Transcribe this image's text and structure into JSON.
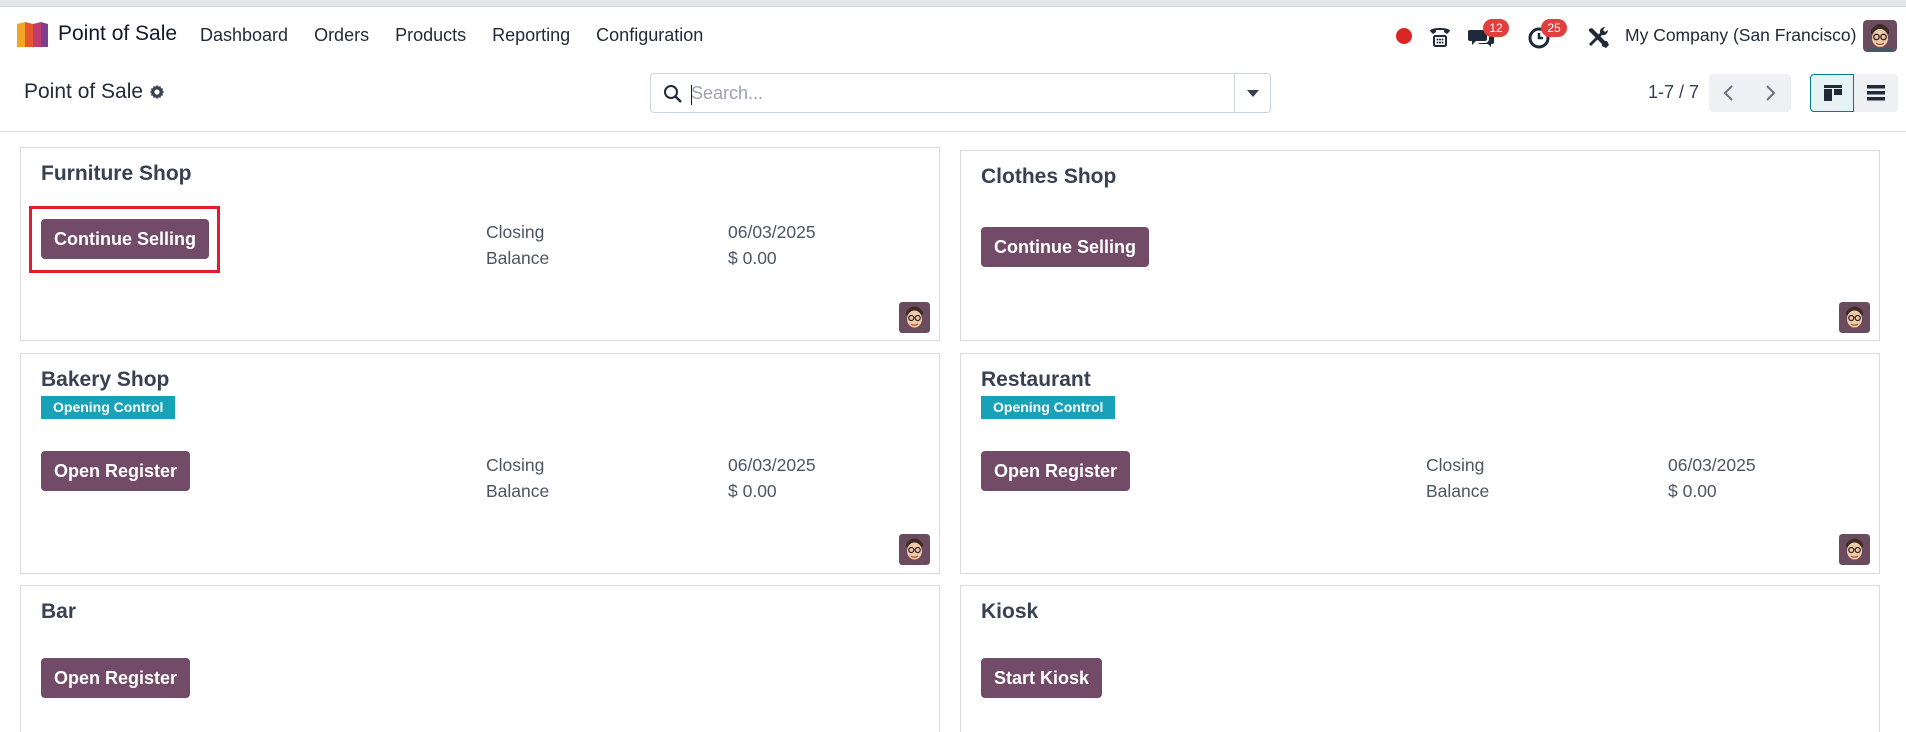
{
  "app": {
    "name": "Point of Sale"
  },
  "menu": [
    "Dashboard",
    "Orders",
    "Products",
    "Reporting",
    "Configuration"
  ],
  "systray": {
    "messages_count": "12",
    "activities_count": "25",
    "company": "My Company (San Francisco)"
  },
  "control_panel": {
    "title": "Point of Sale",
    "search_placeholder": "Search...",
    "pager": "1-7 / 7"
  },
  "colors": {
    "primary": "#714b67",
    "tag": "#17a2b8",
    "badge": "#e0403d",
    "highlight": "#e11d2e"
  },
  "cards": [
    {
      "title": "Furniture Shop",
      "button": "Continue Selling",
      "closing_label": "Closing",
      "closing_date": "06/03/2025",
      "balance_label": "Balance",
      "balance": "$ 0.00"
    },
    {
      "title": "Clothes Shop",
      "button": "Continue Selling"
    },
    {
      "title": "Bakery Shop",
      "tag": "Opening Control",
      "button": "Open Register",
      "closing_label": "Closing",
      "closing_date": "06/03/2025",
      "balance_label": "Balance",
      "balance": "$ 0.00"
    },
    {
      "title": "Restaurant",
      "tag": "Opening Control",
      "button": "Open Register",
      "closing_label": "Closing",
      "closing_date": "06/03/2025",
      "balance_label": "Balance",
      "balance": "$ 0.00"
    },
    {
      "title": "Bar",
      "button": "Open Register"
    },
    {
      "title": "Kiosk",
      "button": "Start Kiosk"
    }
  ]
}
